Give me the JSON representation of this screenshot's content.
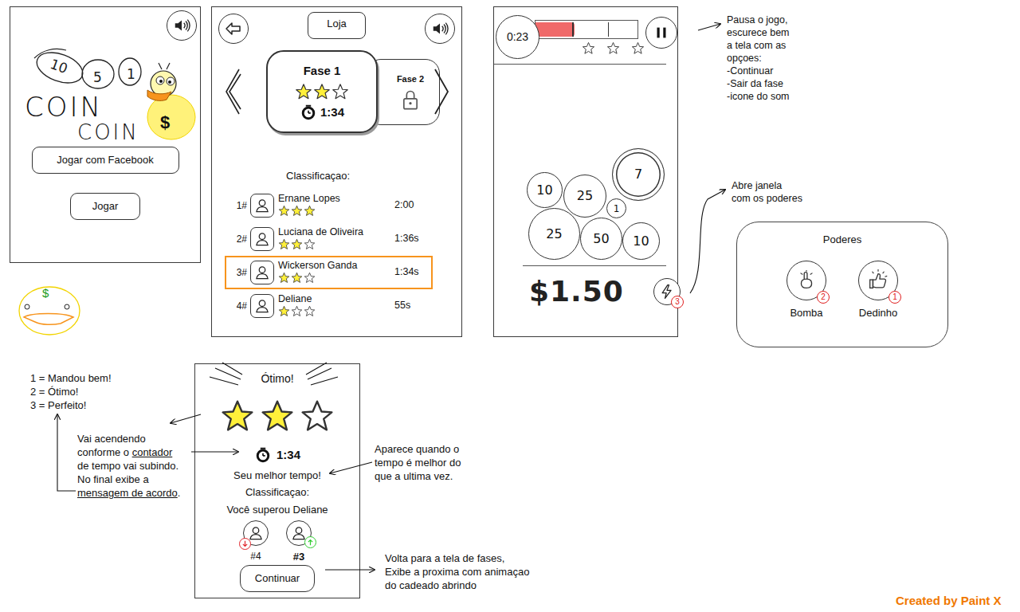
{
  "login_screen": {
    "logo": {
      "coin_numbers": [
        "10",
        "5",
        "1"
      ],
      "title": [
        "COIN",
        "COIN"
      ],
      "duck_sign": "$"
    },
    "buttons": [
      {
        "label": "Jogar com Facebook"
      },
      {
        "label": "Jogar"
      }
    ]
  },
  "duck_sketch": {
    "sign": "$"
  },
  "stages_screen": {
    "shop_button": "Loja",
    "stages": [
      {
        "title": "Fase 1",
        "stars": 2,
        "time": "1:34",
        "locked": false,
        "selected": true
      },
      {
        "title": "Fase 2",
        "locked": true,
        "selected": false
      }
    ],
    "ranking_title": "Classificaçao:",
    "ranking": [
      {
        "rank": "1#",
        "name": "Ernane Lopes",
        "time": "2:00",
        "stars": 3,
        "selected": false
      },
      {
        "rank": "2#",
        "name": "Luciana de Oliveira",
        "time": "1:36s",
        "stars": 2,
        "selected": false
      },
      {
        "rank": "3#",
        "name": "Wickerson Ganda",
        "time": "1:34s",
        "stars": 2,
        "selected": true
      },
      {
        "rank": "4#",
        "name": "Deliane",
        "time": "55s",
        "stars": 1,
        "selected": false
      }
    ]
  },
  "game_screen": {
    "timer": "0:23",
    "progress": {
      "level": 0.38
    },
    "goal_stars": {
      "stars": 0
    },
    "coins": [
      {
        "value": "10",
        "kind": "plain"
      },
      {
        "value": "25",
        "kind": "plain"
      },
      {
        "value": "7",
        "kind": "double"
      },
      {
        "value": "1",
        "kind": "plain"
      },
      {
        "value": "25",
        "kind": "plain"
      },
      {
        "value": "50",
        "kind": "plain"
      },
      {
        "value": "10",
        "kind": "plain"
      }
    ],
    "money": "$1.50",
    "power_count": "3"
  },
  "powers_panel": {
    "title": "Poderes",
    "items": [
      {
        "name": "Bomba",
        "count": "2"
      },
      {
        "name": "Dedinho",
        "count": "1"
      }
    ]
  },
  "result_screen": {
    "title": "Ótimo!",
    "stars": 2,
    "time": "1:34",
    "best_time": "Seu melhor tempo!",
    "ranking_title": "Classificaçao:",
    "overtake": "Você superou Deliane",
    "players": [
      {
        "rank": "#4",
        "trend": "down",
        "color": "#e0242a"
      },
      {
        "rank": "#3",
        "trend": "up",
        "color": "#2ecc2e"
      }
    ],
    "continue_button": "Continuar"
  },
  "notes": {
    "pause": [
      "Pausa o jogo,",
      "escurece bem",
      "a tela com as",
      "opçoes:",
      "-Continuar",
      "-Sair da fase",
      "-icone do som"
    ],
    "powers": [
      "Abre janela",
      "com os poderes"
    ],
    "rating_legend": [
      "1 = Mandou bem!",
      "2 = Ótimo!",
      "3 = Perfeito!"
    ],
    "stars": [
      [
        {
          "text": "Vai acendendo",
          "underline": false
        }
      ],
      [
        {
          "text": "conforme o ",
          "underline": false
        },
        {
          "text": "contador",
          "underline": true
        }
      ],
      [
        {
          "text": "de tempo vai subindo.",
          "underline": false
        }
      ],
      [
        {
          "text": "No final exibe a",
          "underline": false
        }
      ],
      [
        {
          "text": "mensagem de acordo",
          "underline": true
        },
        {
          "text": ".",
          "underline": false
        }
      ]
    ],
    "best_time": [
      "Aparece quando o",
      "tempo é melhor do",
      "que a ultima vez."
    ],
    "continue": [
      "Volta para a tela de fases,",
      "Exibe a proxima com animaçao",
      "do cadeado abrindo"
    ]
  },
  "footer": "Created by Paint X"
}
